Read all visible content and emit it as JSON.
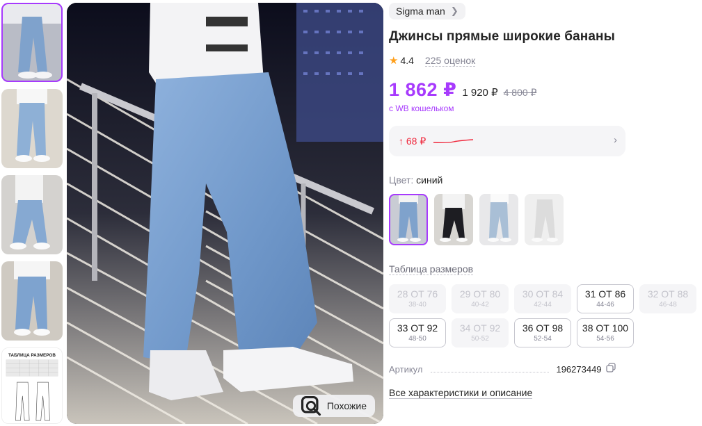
{
  "gallery": {
    "thumbnails": [
      {
        "name": "thumb-1",
        "active": true
      },
      {
        "name": "thumb-2",
        "active": false
      },
      {
        "name": "thumb-3",
        "active": false
      },
      {
        "name": "thumb-4",
        "active": false
      },
      {
        "name": "thumb-5-size-chart",
        "active": false,
        "caption": "ТАБЛИЦА РАЗМЕРОВ"
      }
    ],
    "similar_label": "Похожие"
  },
  "product": {
    "brand": "Sigma man",
    "title": "Джинсы прямые широкие бананы",
    "rating": "4.4",
    "reviews": "225 оценок",
    "price": "1 862 ₽",
    "price_regular": "1 920 ₽",
    "price_old": "4 800 ₽",
    "wallet_note": "с WB кошельком",
    "price_change": "↑ 68 ₽",
    "color_label": "Цвет:",
    "color_value": "синий",
    "size_table_link": "Таблица размеров",
    "sizes": [
      {
        "label": "28 ОТ 76",
        "ru": "38-40",
        "available": false
      },
      {
        "label": "29 ОТ 80",
        "ru": "40-42",
        "available": false
      },
      {
        "label": "30 ОТ 84",
        "ru": "42-44",
        "available": false
      },
      {
        "label": "31 ОТ 86",
        "ru": "44-46",
        "available": true
      },
      {
        "label": "32 ОТ 88",
        "ru": "46-48",
        "available": false
      },
      {
        "label": "33 ОТ 92",
        "ru": "48-50",
        "available": true
      },
      {
        "label": "34 ОТ 92",
        "ru": "50-52",
        "available": false
      },
      {
        "label": "36 ОТ 98",
        "ru": "52-54",
        "available": true
      },
      {
        "label": "38 ОТ 100",
        "ru": "54-56",
        "available": true
      }
    ],
    "article_label": "Артикул",
    "article_value": "196273449",
    "all_specs": "Все характеристики и описание"
  },
  "colors": {
    "accent": "#a73afd",
    "price_up": "#f0293d",
    "star": "#ff9f1a"
  }
}
